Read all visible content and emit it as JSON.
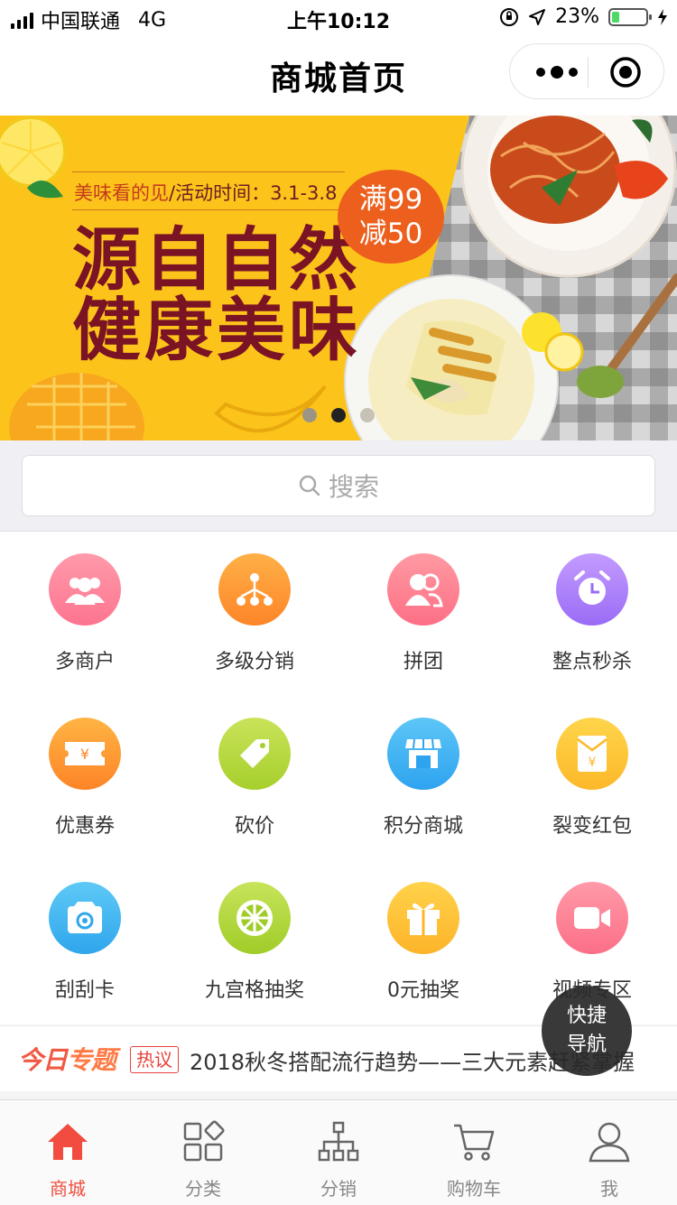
{
  "status_bar": {
    "carrier": "中国联通",
    "network": "4G",
    "time": "上午10:12",
    "battery": "23%",
    "battery_level": 0.23
  },
  "nav": {
    "title": "商城首页"
  },
  "banner": {
    "tagline_highlight": "美味看的见",
    "tagline_rest": "/活动时间：3.1-3.8",
    "title_line1": "源自自然",
    "title_line2": "健康美味",
    "promo_line1": "满99",
    "promo_line2": "减50",
    "active_slide": 2,
    "slide_count": 3
  },
  "search": {
    "placeholder": "搜索"
  },
  "grid": [
    {
      "label": "多商户",
      "icon": "merchants-icon",
      "color1": "#ff9aaa",
      "color2": "#fd7590"
    },
    {
      "label": "多级分销",
      "icon": "distribution-tree-icon",
      "color1": "#ffb047",
      "color2": "#fd8528"
    },
    {
      "label": "拼团",
      "icon": "group-buy-icon",
      "color1": "#ff9aa2",
      "color2": "#fd6f86"
    },
    {
      "label": "整点秒杀",
      "icon": "alarm-clock-icon",
      "color1": "#c39bff",
      "color2": "#9a6cf6"
    },
    {
      "label": "优惠券",
      "icon": "coupon-icon",
      "color1": "#ffb444",
      "color2": "#fd8427"
    },
    {
      "label": "砍价",
      "icon": "price-tag-icon",
      "color1": "#c9e35a",
      "color2": "#a6cf2b"
    },
    {
      "label": "积分商城",
      "icon": "store-icon",
      "color1": "#5cc6f7",
      "color2": "#2ea3ef"
    },
    {
      "label": "裂变红包",
      "icon": "red-envelope-icon",
      "color1": "#ffd54a",
      "color2": "#fcb82a"
    },
    {
      "label": "刮刮卡",
      "icon": "scratch-card-icon",
      "color1": "#5ec9f6",
      "color2": "#2fa6ec"
    },
    {
      "label": "九宫格抽奖",
      "icon": "lottery-wheel-icon",
      "color1": "#c7e45a",
      "color2": "#a0cc28"
    },
    {
      "label": "0元抽奖",
      "icon": "gift-icon",
      "color1": "#ffd24a",
      "color2": "#fcb42a"
    },
    {
      "label": "视频专区",
      "icon": "video-camera-icon",
      "color1": "#ff9aa8",
      "color2": "#fc6f88"
    }
  ],
  "news": {
    "logo_part1": "今日",
    "logo_part2": "专题",
    "tag": "热议",
    "text": "2018秋冬搭配流行趋势——三大元素赶紧掌握"
  },
  "fab": {
    "line1": "快捷",
    "line2": "导航"
  },
  "tabbar": [
    {
      "label": "商城",
      "icon": "home-icon",
      "active": true
    },
    {
      "label": "分类",
      "icon": "category-icon",
      "active": false
    },
    {
      "label": "分销",
      "icon": "distribution-icon",
      "active": false
    },
    {
      "label": "购物车",
      "icon": "cart-icon",
      "active": false
    },
    {
      "label": "我",
      "icon": "user-icon",
      "active": false
    }
  ],
  "colors": {
    "accent": "#f14c3f",
    "banner_bg": "#fcc41b",
    "banner_title": "#7a1324"
  }
}
